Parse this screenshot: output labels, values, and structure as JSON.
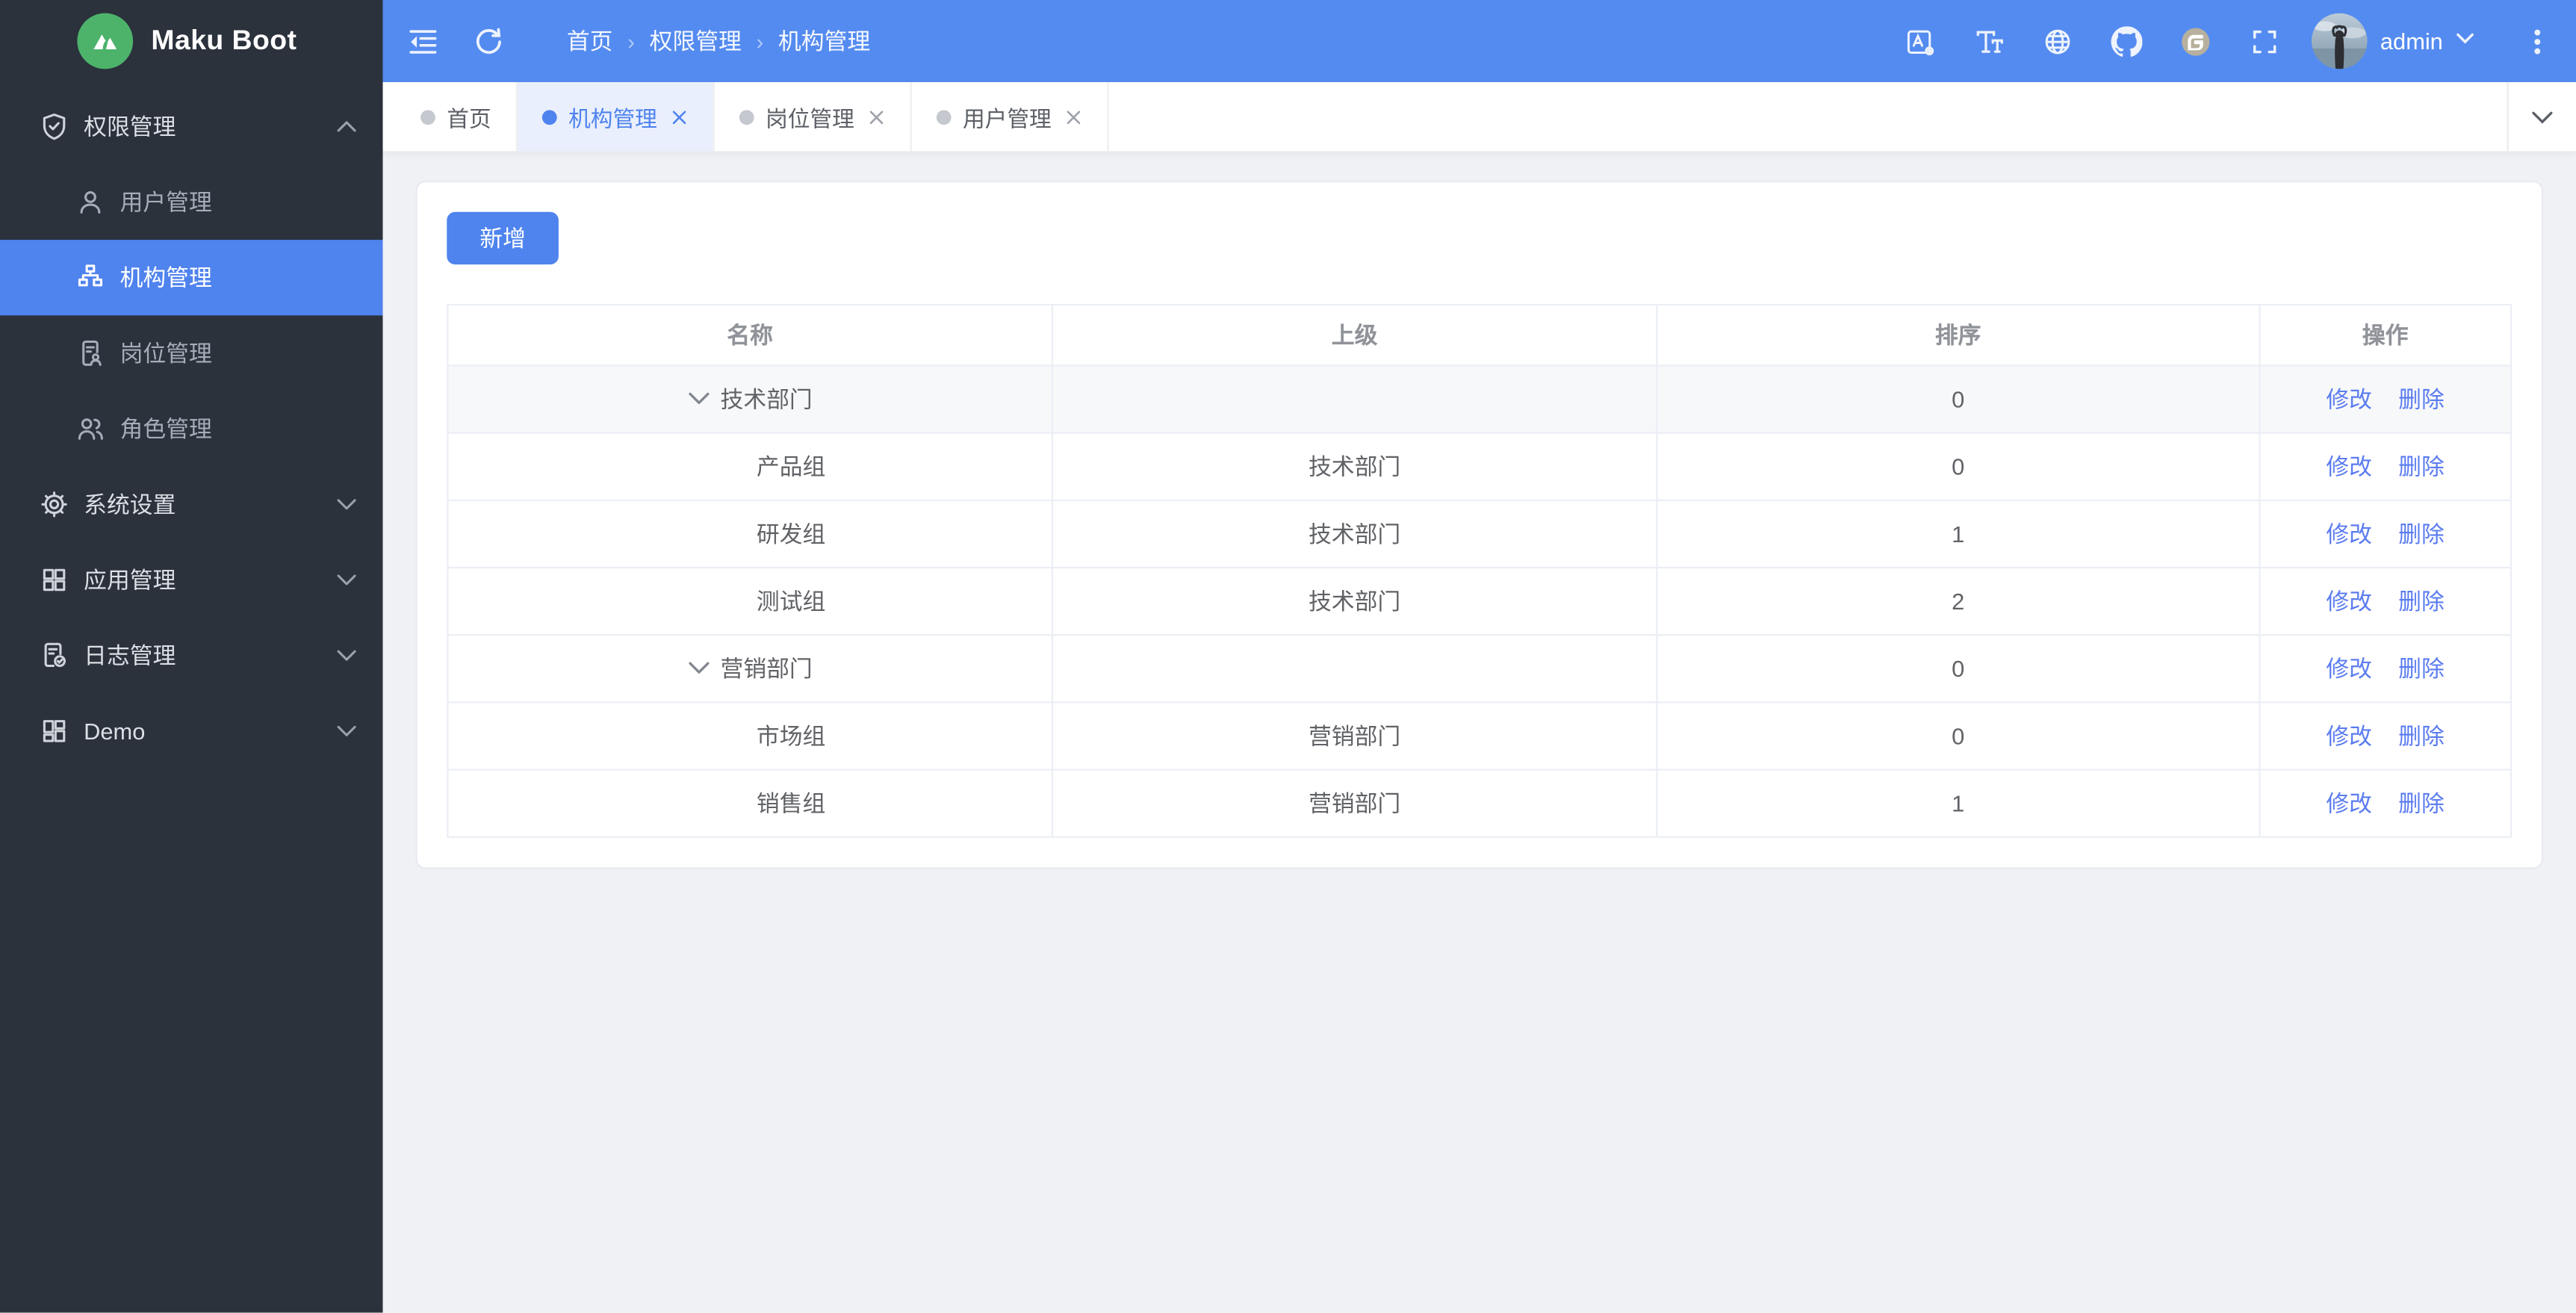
{
  "app": {
    "name": "Maku Boot",
    "logo_icon": "mountain-logo-icon"
  },
  "header": {
    "breadcrumb": [
      "首页",
      "权限管理",
      "机构管理"
    ],
    "left_icons": [
      {
        "name": "collapse-sidebar-icon"
      },
      {
        "name": "refresh-icon"
      }
    ],
    "right_icons": [
      {
        "name": "translate-icon"
      },
      {
        "name": "font-size-icon"
      },
      {
        "name": "globe-icon"
      },
      {
        "name": "github-icon"
      },
      {
        "name": "gitee-icon"
      },
      {
        "name": "fullscreen-icon"
      }
    ],
    "user": {
      "name": "admin",
      "avatar": "avatar-photo",
      "caret": "chevron-down-icon"
    },
    "more_icon": "kebab-menu-icon"
  },
  "sidebar": {
    "sections": [
      {
        "label": "权限管理",
        "icon": "shield-check-icon",
        "expanded": true,
        "children": [
          {
            "label": "用户管理",
            "icon": "user-icon",
            "active": false
          },
          {
            "label": "机构管理",
            "icon": "org-tree-icon",
            "active": true
          },
          {
            "label": "岗位管理",
            "icon": "post-doc-icon",
            "active": false
          },
          {
            "label": "角色管理",
            "icon": "roles-icon",
            "active": false
          }
        ]
      },
      {
        "label": "系统设置",
        "icon": "gear-icon",
        "expanded": false,
        "children": []
      },
      {
        "label": "应用管理",
        "icon": "apps-grid-icon",
        "expanded": false,
        "children": []
      },
      {
        "label": "日志管理",
        "icon": "log-doc-icon",
        "expanded": false,
        "children": []
      },
      {
        "label": "Demo",
        "icon": "demo-grid-icon",
        "expanded": false,
        "children": []
      }
    ]
  },
  "tabs": [
    {
      "label": "首页",
      "active": false,
      "closable": false
    },
    {
      "label": "机构管理",
      "active": true,
      "closable": true
    },
    {
      "label": "岗位管理",
      "active": false,
      "closable": true
    },
    {
      "label": "用户管理",
      "active": false,
      "closable": true
    }
  ],
  "toolbar": {
    "add_label": "新增"
  },
  "table": {
    "headers": [
      "名称",
      "上级",
      "排序",
      "操作"
    ],
    "actions": {
      "edit": "修改",
      "delete": "删除"
    },
    "rows": [
      {
        "name": "技术部门",
        "parent": "",
        "sort": "0",
        "level": 0,
        "expandable": true,
        "hover": true
      },
      {
        "name": "产品组",
        "parent": "技术部门",
        "sort": "0",
        "level": 1,
        "expandable": false,
        "hover": false
      },
      {
        "name": "研发组",
        "parent": "技术部门",
        "sort": "1",
        "level": 1,
        "expandable": false,
        "hover": false
      },
      {
        "name": "测试组",
        "parent": "技术部门",
        "sort": "2",
        "level": 1,
        "expandable": false,
        "hover": false
      },
      {
        "name": "营销部门",
        "parent": "",
        "sort": "0",
        "level": 0,
        "expandable": true,
        "hover": false
      },
      {
        "name": "市场组",
        "parent": "营销部门",
        "sort": "0",
        "level": 1,
        "expandable": false,
        "hover": false
      },
      {
        "name": "销售组",
        "parent": "营销部门",
        "sort": "1",
        "level": 1,
        "expandable": false,
        "hover": false
      }
    ]
  },
  "colors": {
    "primary": "#4f83ee",
    "header_bg": "#548bf0",
    "sidebar_bg": "#2b323c",
    "sidebar_active_bg": "#4f83ee",
    "content_bg": "#f0f1f5",
    "link": "#5b7cf0",
    "logo_green": "#4db36b",
    "border": "#ebeef5",
    "head_text": "#909399",
    "cell_text": "#606266"
  }
}
